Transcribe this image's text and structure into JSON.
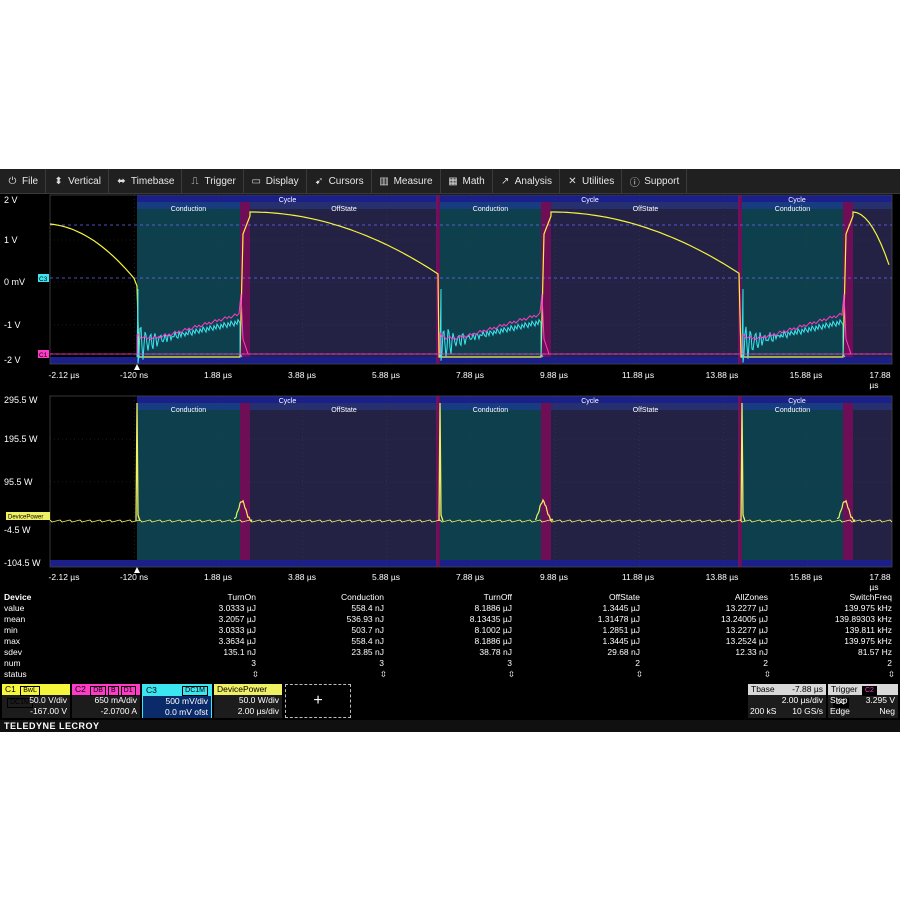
{
  "menu": [
    {
      "label": "File",
      "icon": "power-icon",
      "glyph": "⏻"
    },
    {
      "label": "Vertical",
      "icon": "vertical-arrows-icon",
      "glyph": "⬍"
    },
    {
      "label": "Timebase",
      "icon": "horizontal-arrows-icon",
      "glyph": "⬌"
    },
    {
      "label": "Trigger",
      "icon": "trigger-icon",
      "glyph": "⎍"
    },
    {
      "label": "Display",
      "icon": "display-icon",
      "glyph": "▭"
    },
    {
      "label": "Cursors",
      "icon": "cursor-icon",
      "glyph": "➹"
    },
    {
      "label": "Measure",
      "icon": "measure-icon",
      "glyph": "▥"
    },
    {
      "label": "Math",
      "icon": "math-icon",
      "glyph": "▦"
    },
    {
      "label": "Analysis",
      "icon": "analysis-icon",
      "glyph": "↗"
    },
    {
      "label": "Utilities",
      "icon": "wrench-icon",
      "glyph": "✕"
    },
    {
      "label": "Support",
      "icon": "info-icon",
      "glyph": "ⓘ"
    }
  ],
  "colors": {
    "c1": "#f5f53c",
    "c2": "#ff3cc8",
    "c3": "#3ce6f0",
    "math": "#f0f064",
    "conduction_zone": "#0f4a5a",
    "offstate_zone": "#2a2850",
    "edge_zone": "#7a1060",
    "zone_bar": "#1a1f8a"
  },
  "upper": {
    "y_labels": [
      "2 V",
      "1 V",
      "0 mV",
      "-1 V",
      "-2 V"
    ],
    "x_labels": [
      "-2.12 µs",
      "-120 ns",
      "1.88 µs",
      "3.88 µs",
      "5.88 µs",
      "7.88 µs",
      "9.88 µs",
      "11.88 µs",
      "13.88 µs",
      "15.88 µs",
      "17.88 µs"
    ],
    "markers": {
      "c3": "C3",
      "c1": "C1"
    }
  },
  "lower": {
    "y_labels": [
      "295.5 W",
      "195.5 W",
      "95.5 W",
      "-4.5 W",
      "-104.5 W"
    ],
    "x_labels": [
      "-2.12 µs",
      "-120 ns",
      "1.88 µs",
      "3.88 µs",
      "5.88 µs",
      "7.88 µs",
      "9.88 µs",
      "11.88 µs",
      "13.88 µs",
      "15.88 µs",
      "17.88 µs"
    ],
    "marker": "DevicePower"
  },
  "zones": {
    "cycle_label": "Cycle",
    "conduction_label": "Conduction",
    "offstate_label": "OffState"
  },
  "measurements": {
    "header": [
      "Device",
      "TurnOn",
      "Conduction",
      "TurnOff",
      "OffState",
      "AllZones",
      "SwitchFreq"
    ],
    "rows": [
      [
        "value",
        "3.0333 µJ",
        "558.4 nJ",
        "8.1886 µJ",
        "1.3445 µJ",
        "13.2277 µJ",
        "139.975 kHz"
      ],
      [
        "mean",
        "3.2057 µJ",
        "536.93 nJ",
        "8.13435 µJ",
        "1.31478 µJ",
        "13.24005 µJ",
        "139.89303 kHz"
      ],
      [
        "min",
        "3.0333 µJ",
        "503.7 nJ",
        "8.1002 µJ",
        "1.2851 µJ",
        "13.2277 µJ",
        "139.811 kHz"
      ],
      [
        "max",
        "3.3634 µJ",
        "558.4 nJ",
        "8.1886 µJ",
        "1.3445 µJ",
        "13.2524 µJ",
        "139.975 kHz"
      ],
      [
        "sdev",
        "135.1 nJ",
        "23.85 nJ",
        "38.78 nJ",
        "29.68 nJ",
        "12.33 nJ",
        "81.57 Hz"
      ],
      [
        "num",
        "3",
        "3",
        "3",
        "2",
        "2",
        "2"
      ],
      [
        "status",
        "⇳",
        "⇳",
        "⇳",
        "⇳",
        "⇳",
        "⇳"
      ]
    ]
  },
  "channels": {
    "c1": {
      "name": "C1",
      "tags": [
        "BwL",
        "DC1M"
      ],
      "scale": "50.0 V/div",
      "offset": "-167.00 V"
    },
    "c2": {
      "name": "C2",
      "tags": [
        "DB",
        "B",
        "D1"
      ],
      "scale": "650 mA/div",
      "offset": "-2.0700 A"
    },
    "c3": {
      "name": "C3",
      "tags": [
        "DC1M"
      ],
      "scale": "500 mV/div",
      "offset": "0.0 mV ofst"
    },
    "math": {
      "name": "DevicePower",
      "scale": "50.0 W/div",
      "offset": "2.00 µs/div"
    },
    "add_label": "+"
  },
  "timebase": {
    "title": "Tbase",
    "delay": "-7.88 µs",
    "scale": "2.00 µs/div",
    "samples": "200 kS",
    "rate": "10 GS/s"
  },
  "trigger": {
    "title": "Trigger",
    "tags": [
      "C2",
      "DC"
    ],
    "mode": "Stop",
    "level": "3.295 V",
    "type": "Edge",
    "slope": "Neg"
  },
  "brand": "TELEDYNE LECROY"
}
